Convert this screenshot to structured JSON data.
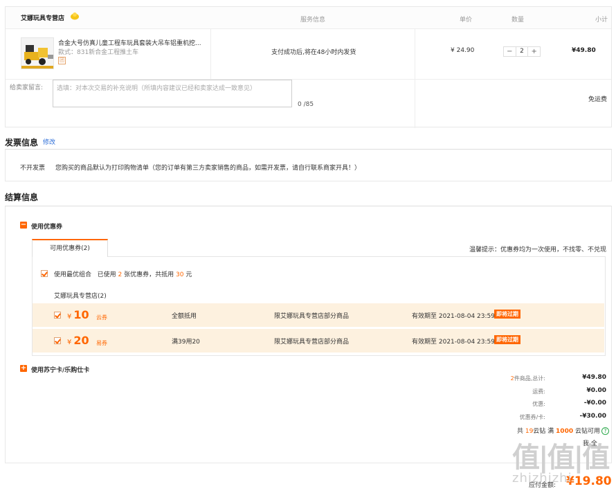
{
  "order": {
    "shop_name": "艾娜玩具专营店",
    "columns": {
      "service": "服务信息",
      "price": "单价",
      "quantity": "数量",
      "subtotal": "小计"
    },
    "item": {
      "title": "合金大号仿真儿童工程车玩具套装大吊车铝重机挖...",
      "spec": "款式：831新合金工程推土车",
      "tag": "团",
      "service": "支付成功后,将在48小时内发货",
      "price": "¥ 24.90",
      "quantity": "2",
      "minus": "−",
      "plus": "+",
      "subtotal": "¥49.80"
    },
    "message": {
      "label": "给卖家留言:",
      "placeholder": "选填：对本次交易的补充说明（所填内容建议已经和卖家达成一致意见）",
      "count": "0 /85"
    },
    "shipping": "免运费"
  },
  "invoice": {
    "title": "发票信息",
    "edit": "修改",
    "type": "不开发票",
    "desc": "您购买的商品默认为打印购物清单（您的订单有第三方卖家销售的商品，如需开发票，请自行联系商家开具！）"
  },
  "settlement": {
    "title": "结算信息",
    "coupon_toggle": "使用优惠券",
    "coupon_toggle_icon": "−",
    "tab_label": "可用优惠券(2)",
    "tip": "温馨提示：优惠券均为一次使用，不找零、不兑现",
    "best": {
      "prefix": "使用最优组合",
      "used_pre": "已使用",
      "used_count": "2",
      "used_mid": "张优惠券，共抵用",
      "amount": "30",
      "unit": "元"
    },
    "shop_group": "艾娜玩具专营店(2)",
    "coupons": [
      {
        "currency": "¥",
        "amount": "10",
        "type": "云券",
        "condition": "全额抵用",
        "scope": "限艾娜玩具专营店部分商品",
        "valid": "有效期至 2021-08-04 23:59",
        "expiring": "即将过期"
      },
      {
        "currency": "¥",
        "amount": "20",
        "type": "易券",
        "condition": "满39用20",
        "scope": "限艾娜玩具专营店部分商品",
        "valid": "有效期至 2021-08-04 23:59",
        "expiring": "即将过期"
      }
    ],
    "card_toggle": "使用苏宁卡/乐购仕卡",
    "card_toggle_icon": "+",
    "summary": {
      "items_count": "2",
      "items_label": "件商品,总计:",
      "items_total": "¥49.80",
      "shipping_label": "运费:",
      "shipping": "¥0.00",
      "discount_label": "优惠:",
      "discount": "-¥0.00",
      "coupon_label": "优惠券/卡:",
      "coupon": "-¥30.00"
    },
    "cloud": {
      "pre": "共",
      "count": "19",
      "mid": "云钻 满",
      "threshold": "1000",
      "post": "云钻可用",
      "help": "?"
    },
    "select_all": "我 全",
    "pay_label": "应付金额:",
    "pay_value": "¥19.80"
  },
  "watermark": {
    "logo": "值|值|值",
    "site": "zhizhizhi"
  },
  "colors": {
    "accent": "#ff6600",
    "link": "#2f6fd8",
    "coupon_bg": "#fdf1df"
  }
}
